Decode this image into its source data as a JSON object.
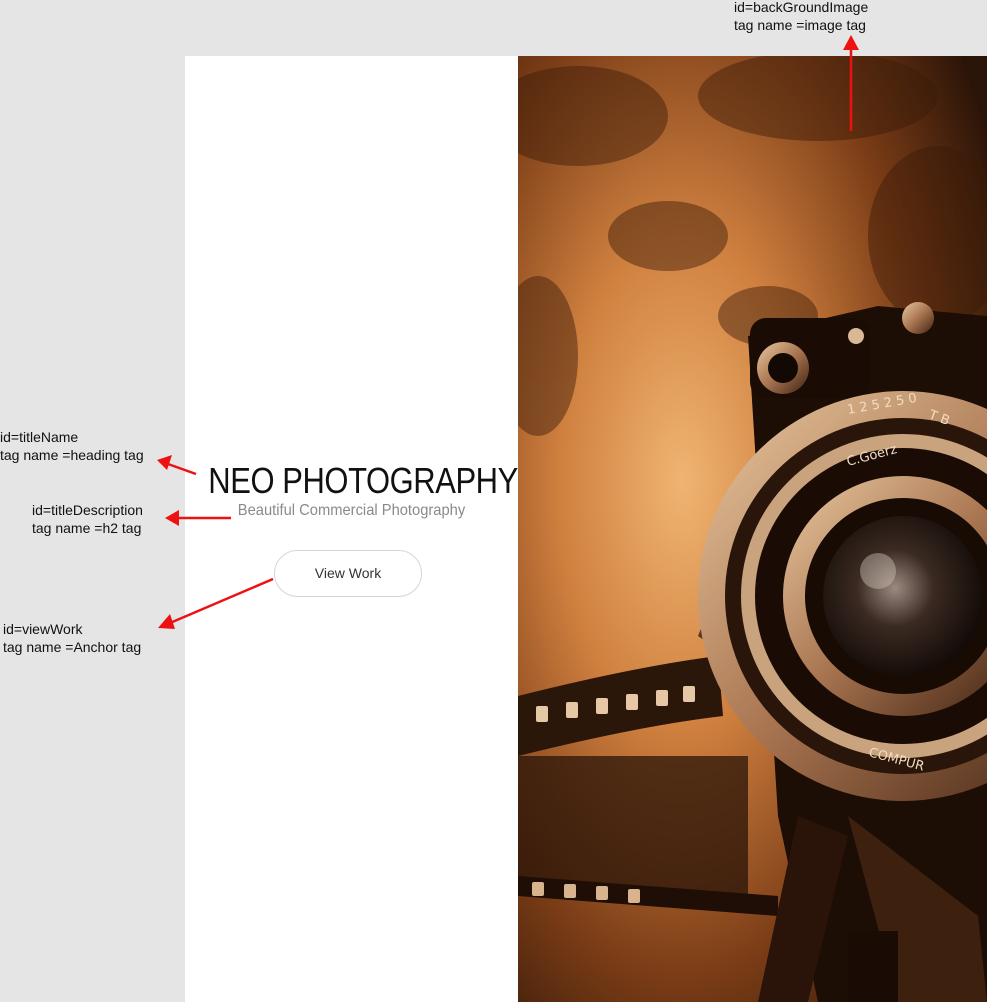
{
  "hero": {
    "title": "NEO PHOTOGRAPHY",
    "subtitle": "Beautiful Commercial Photography",
    "button_label": "View Work"
  },
  "annotations": {
    "background_image": {
      "id_line": "id=backGroundImage",
      "tag_line": "tag name =image tag"
    },
    "title_name": {
      "id_line": "id=titleName",
      "tag_line": "tag name =heading tag"
    },
    "title_description": {
      "id_line": "id=titleDescription",
      "tag_line": "tag name =h2 tag"
    },
    "view_work": {
      "id_line": "id=viewWork",
      "tag_line": "tag name =Anchor tag"
    }
  },
  "colors": {
    "page_background": "#e5e5e5",
    "panel_background": "#ffffff",
    "title_text": "#111111",
    "subtitle_text": "#8a8a8a",
    "arrow": "#ee1111",
    "image_tone": "#c8773a"
  },
  "icons": {
    "annotation_arrow": "red-arrow-icon"
  }
}
